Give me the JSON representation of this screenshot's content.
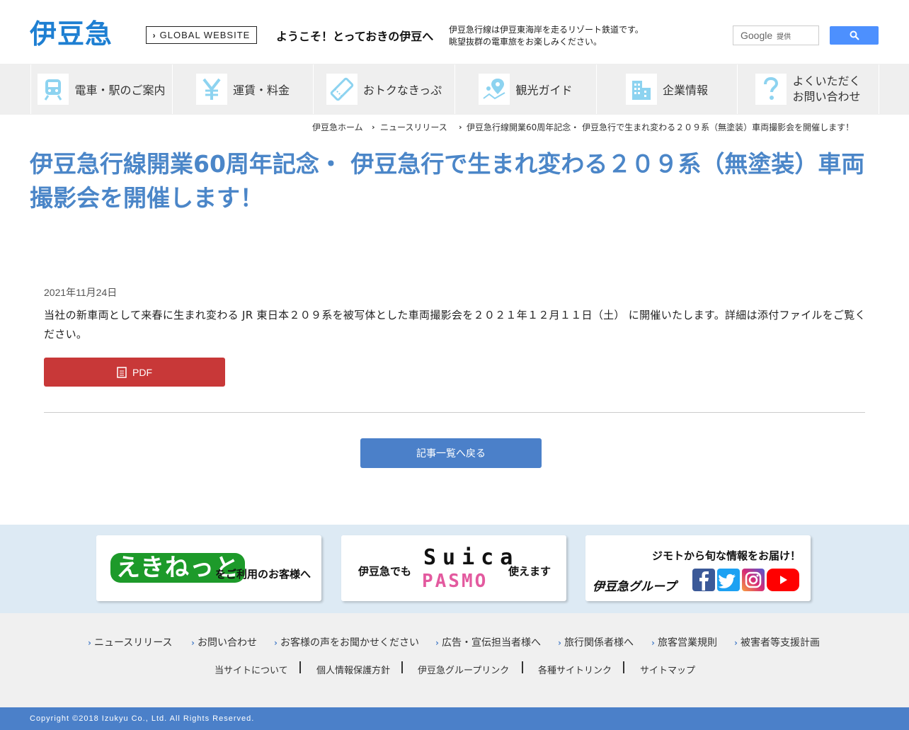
{
  "header": {
    "logo": "伊豆急",
    "global_website": "GLOBAL WEBSITE",
    "welcome": "ようこそ！とっておきの伊豆へ",
    "tagline_1": "伊豆急行線は伊豆東海岸を走るリゾート鉄道です。",
    "tagline_2": "眺望抜群の電車旅をお楽しみください。",
    "search_google": "Google",
    "search_provided": "提供"
  },
  "nav": {
    "items": [
      {
        "label": "電車・駅のご案内",
        "icon": "train-icon"
      },
      {
        "label": "運賃・料金",
        "icon": "yen-icon"
      },
      {
        "label": "おトクなきっぷ",
        "icon": "ticket-icon"
      },
      {
        "label": "観光ガイド",
        "icon": "map-pin-icon"
      },
      {
        "label": "企業情報",
        "icon": "building-icon"
      },
      {
        "label_1": "よくいただく",
        "label_2": "お問い合わせ",
        "icon": "question-icon"
      }
    ],
    "icon_color": "#8dd3f0"
  },
  "breadcrumb": {
    "home": "伊豆急ホーム",
    "news": "ニュースリリース",
    "current": "伊豆急行線開業60周年記念・ 伊豆急行で生まれ変わる２０９系（無塗装）車両撮影会を開催します！"
  },
  "article": {
    "title": "伊豆急行線開業60周年記念・ 伊豆急行で生まれ変わる２０９系（無塗装）車両撮影会を開催します！",
    "date": "2021年11月24日",
    "body": "当社の新車両として来春に生まれ変わる JR 東日本２０９系を被写体とした車両撮影会を２０２１年１２月１１日（土） に開催いたします。詳細は添付ファイルをご覧ください。",
    "pdf_label": "PDF",
    "back_label": "記事一覧へ戻る"
  },
  "banners": {
    "ekinet_logo": "えきねっと",
    "ekinet_text": "をご利用のお客様へ",
    "suica_left": "伊豆急でも",
    "suica_logo": "Suica",
    "pasmo_logo": "PASMO",
    "suica_right": "使えます",
    "sns_top": "ジモトから旬な情報をお届け！",
    "sns_group": "伊豆急グループ"
  },
  "footer": {
    "links": [
      "ニュースリリース",
      "お問い合わせ",
      "お客様の声をお聞かせください",
      "広告・宣伝担当者様へ",
      "旅行関係者様へ",
      "旅客営業規則",
      "被害者等支援計画"
    ],
    "links2": [
      "当サイトについて",
      "個人情報保護方針",
      "伊豆急グループリンク",
      "各種サイトリンク",
      "サイトマップ"
    ],
    "copyright": "Copyright ©2018 Izukyu Co., Ltd. All Rights Reserved."
  },
  "colors": {
    "brand": "#1e7fd2",
    "title": "#4b86c8",
    "pdf": "#c83838",
    "button": "#4b80c9"
  }
}
